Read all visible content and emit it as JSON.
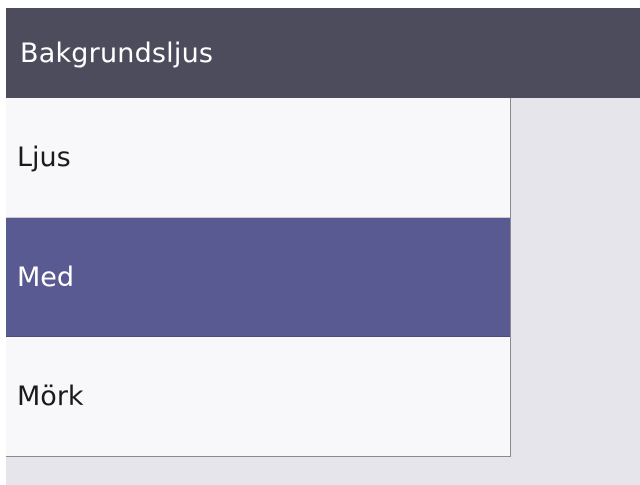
{
  "header": {
    "title": "Bakgrundsljus"
  },
  "options": [
    {
      "label": "Ljus",
      "selected": false
    },
    {
      "label": "Med",
      "selected": true
    },
    {
      "label": "Mörk",
      "selected": false
    }
  ],
  "colors": {
    "header_bg": "#4d4c5c",
    "selected_bg": "#5a5a92",
    "list_bg": "#f8f8fa",
    "screen_bg": "#e5e5eb"
  }
}
